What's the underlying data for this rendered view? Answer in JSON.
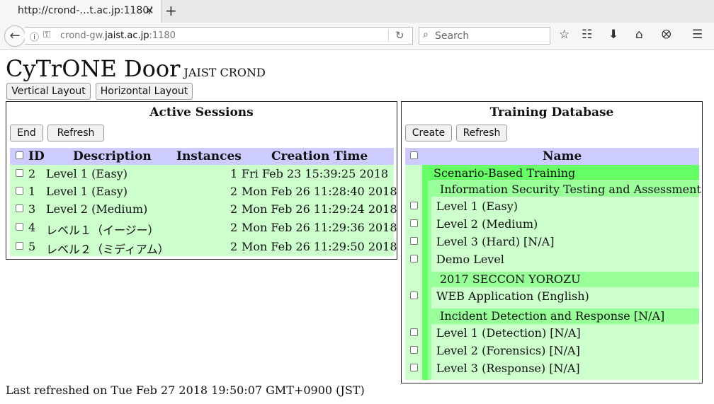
{
  "browser": {
    "tab_title": "http://crond-…t.ac.jp:1180/",
    "tab_close": "✕",
    "new_tab": "+",
    "url_host_pre": "crond-gw.",
    "url_host": "jaist.ac.jp",
    "url_port": ":1180",
    "search_placeholder": "Search",
    "icons": [
      "back-arrow-icon",
      "info-icon",
      "key-icon",
      "reload-icon",
      "search-icon",
      "bookmark-star-icon",
      "reader-list-icon",
      "download-icon",
      "home-icon",
      "pocket-icon",
      "hamburger-menu-icon"
    ]
  },
  "page": {
    "title": "CyTrONE Door",
    "subtitle": "JAIST CROND",
    "vertical_layout_label": "Vertical Layout",
    "horizontal_layout_label": "Horizontal Layout"
  },
  "sessions": {
    "title": "Active Sessions",
    "end_label": "End",
    "refresh_label": "Refresh",
    "headers": {
      "id": "ID",
      "description": "Description",
      "instances": "Instances",
      "creation_time": "Creation Time"
    },
    "rows": [
      {
        "id": "2",
        "description": "Level 1 (Easy)",
        "instances": "1",
        "time": "Fri Feb 23 15:39:25 2018"
      },
      {
        "id": "1",
        "description": "Level 1 (Easy)",
        "instances": "2",
        "time": "Mon Feb 26 11:28:40 2018"
      },
      {
        "id": "3",
        "description": "Level 2 (Medium)",
        "instances": "2",
        "time": "Mon Feb 26 11:29:24 2018"
      },
      {
        "id": "4",
        "description": "レベル１（イージー）",
        "instances": "2",
        "time": "Mon Feb 26 11:29:36 2018"
      },
      {
        "id": "5",
        "description": "レベル２（ミディアム）",
        "instances": "2",
        "time": "Mon Feb 26 11:29:50 2018"
      }
    ]
  },
  "training": {
    "title": "Training Database",
    "create_label": "Create",
    "refresh_label": "Refresh",
    "name_header": "Name",
    "category": "Scenario-Based Training",
    "groups": [
      {
        "name": "Information Security Testing and Assessment",
        "items": [
          "Level 1 (Easy)",
          "Level 2 (Medium)",
          "Level 3 (Hard) [N/A]",
          "Demo Level"
        ]
      },
      {
        "name": "2017 SECCON YOROZU",
        "items": [
          "WEB Application (English)"
        ]
      },
      {
        "name": "Incident Detection and Response [N/A]",
        "items": [
          "Level 1 (Detection) [N/A]",
          "Level 2 (Forensics) [N/A]",
          "Level 3 (Response) [N/A]"
        ]
      }
    ]
  },
  "footer": {
    "last_refreshed": "Last refreshed on Tue Feb 27 2018 19:50:07 GMT+0900 (JST)"
  }
}
